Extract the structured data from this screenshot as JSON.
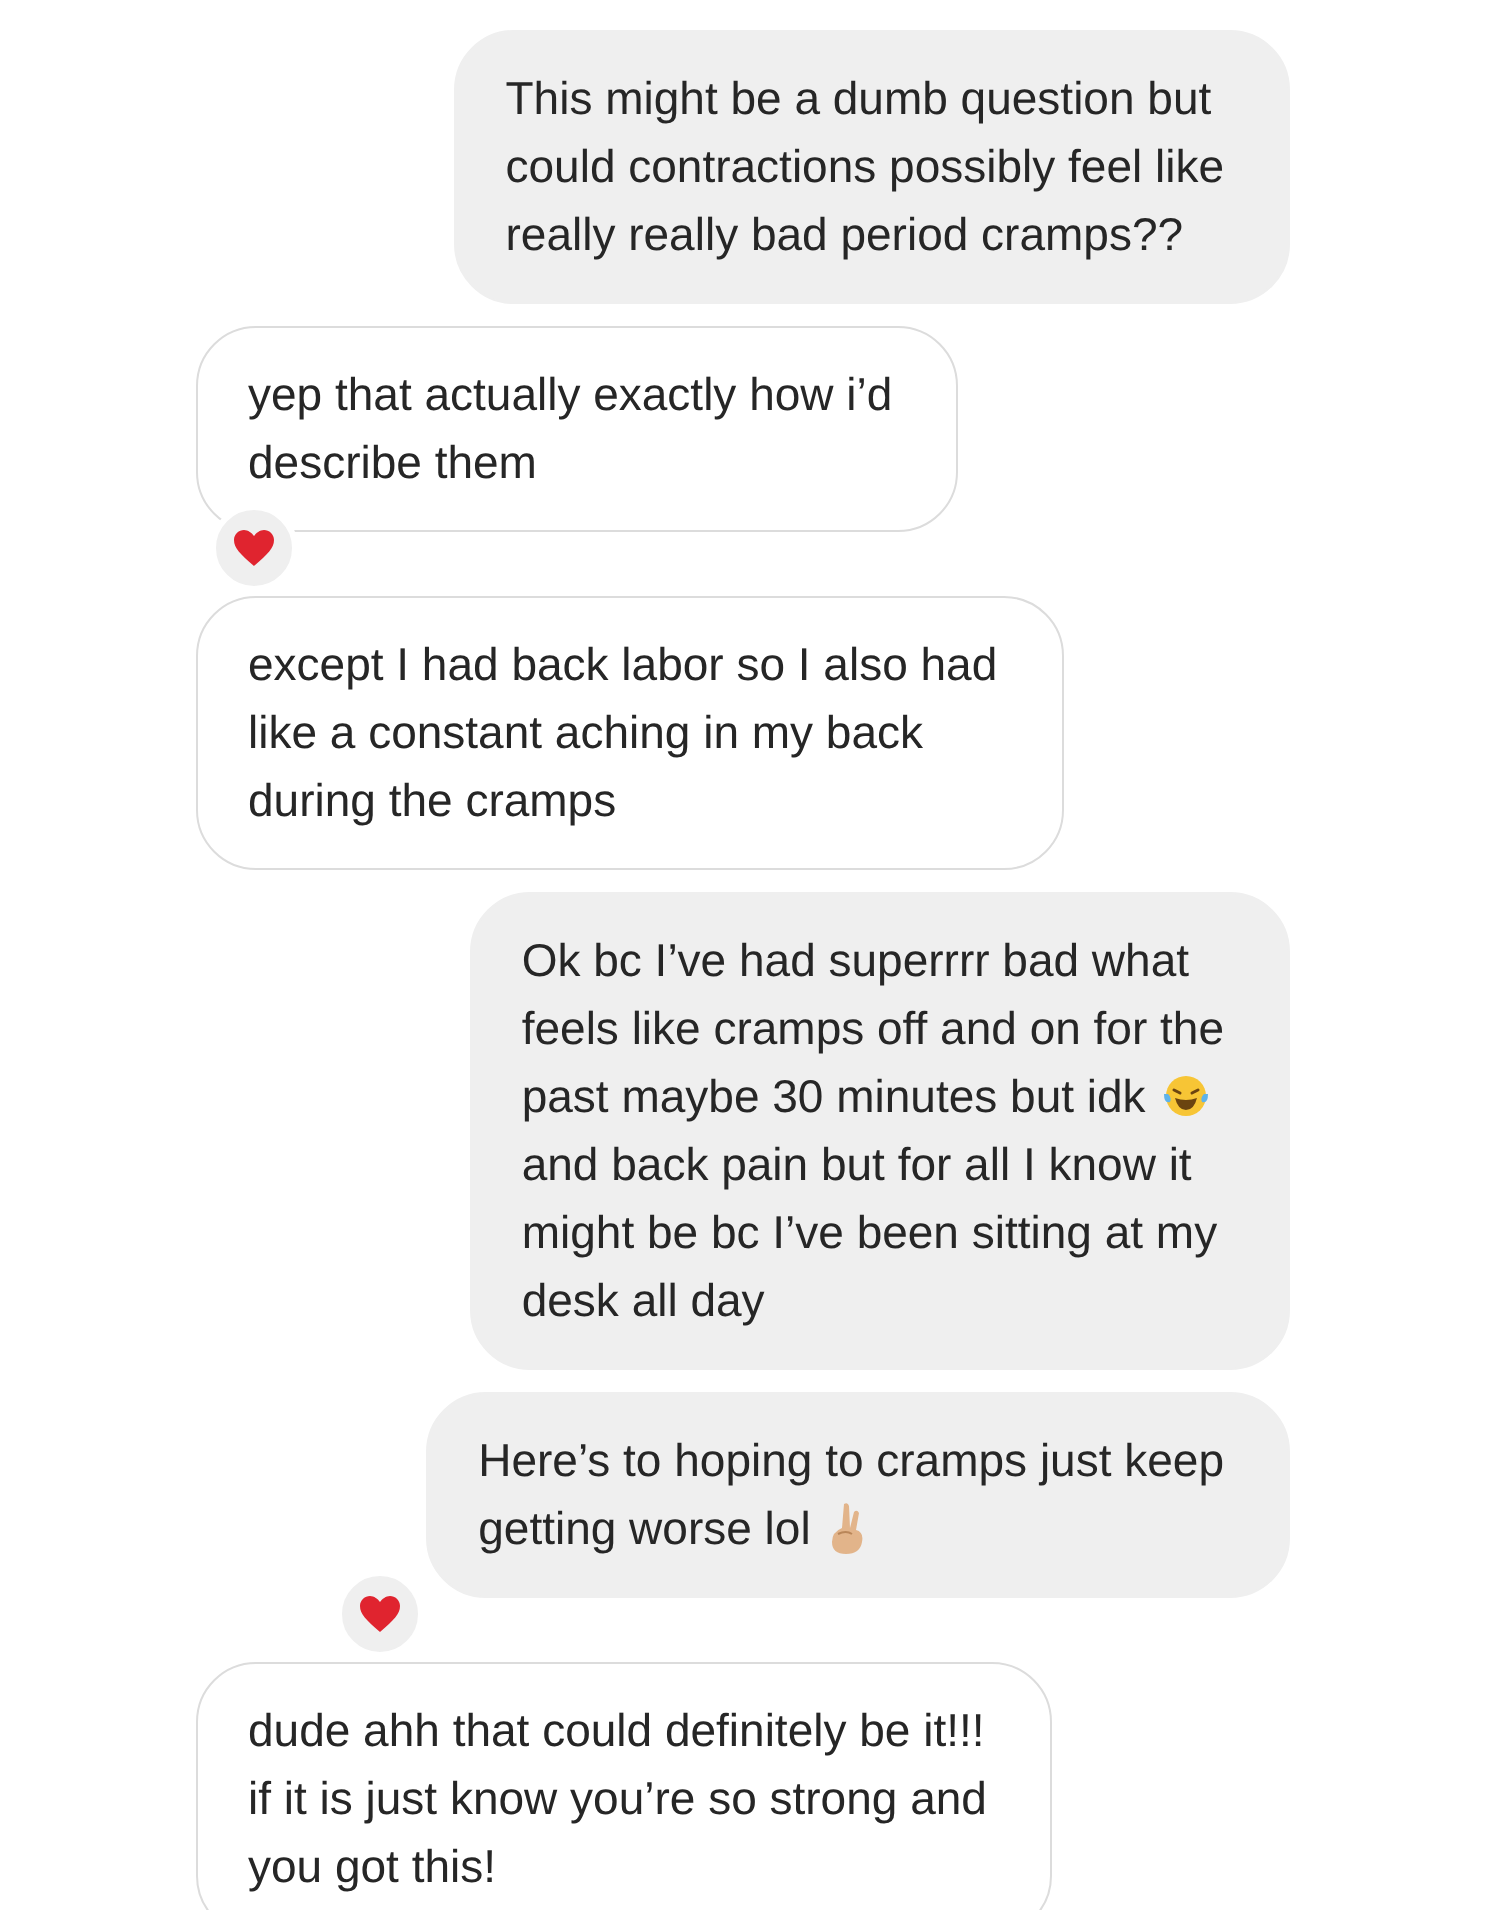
{
  "messages": [
    {
      "kind": "outgoing",
      "lines": [
        {
          "text": "This might be a dumb question but"
        },
        {
          "text": "could contractions possibly feel like"
        },
        {
          "text": "really really bad period cramps??"
        }
      ]
    },
    {
      "kind": "incoming",
      "lines": [
        {
          "text": "yep that actually exactly how i’d"
        },
        {
          "text": "describe them"
        }
      ],
      "reaction": {
        "kind": "heart"
      }
    },
    {
      "kind": "incoming",
      "lines": [
        {
          "text": "except I had back labor so I also had"
        },
        {
          "text": "like a constant aching in my back"
        },
        {
          "text": "during the cramps"
        }
      ]
    },
    {
      "kind": "outgoing",
      "lines": [
        {
          "text": "Ok bc I’ve had superrrr bad what"
        },
        {
          "text": "feels like cramps off and on for the"
        },
        {
          "text": "past maybe 30 minutes but idk",
          "emoji": {
            "kind": "laughing"
          }
        },
        {
          "text": "and back pain but for all I know it"
        },
        {
          "text": "might be bc I’ve been sitting at my"
        },
        {
          "text": "desk all day"
        }
      ]
    },
    {
      "kind": "outgoing",
      "lines": [
        {
          "text": "Here’s to hoping to cramps just keep"
        },
        {
          "text": "getting worse lol",
          "emoji": {
            "kind": "crossed-fingers"
          }
        }
      ],
      "reaction": {
        "kind": "heart"
      }
    },
    {
      "kind": "incoming",
      "lines": [
        {
          "text": "dude ahh that could definitely be it!!!"
        },
        {
          "text": "if it is just know you’re so strong and"
        },
        {
          "text": "you got this!"
        }
      ]
    }
  ]
}
